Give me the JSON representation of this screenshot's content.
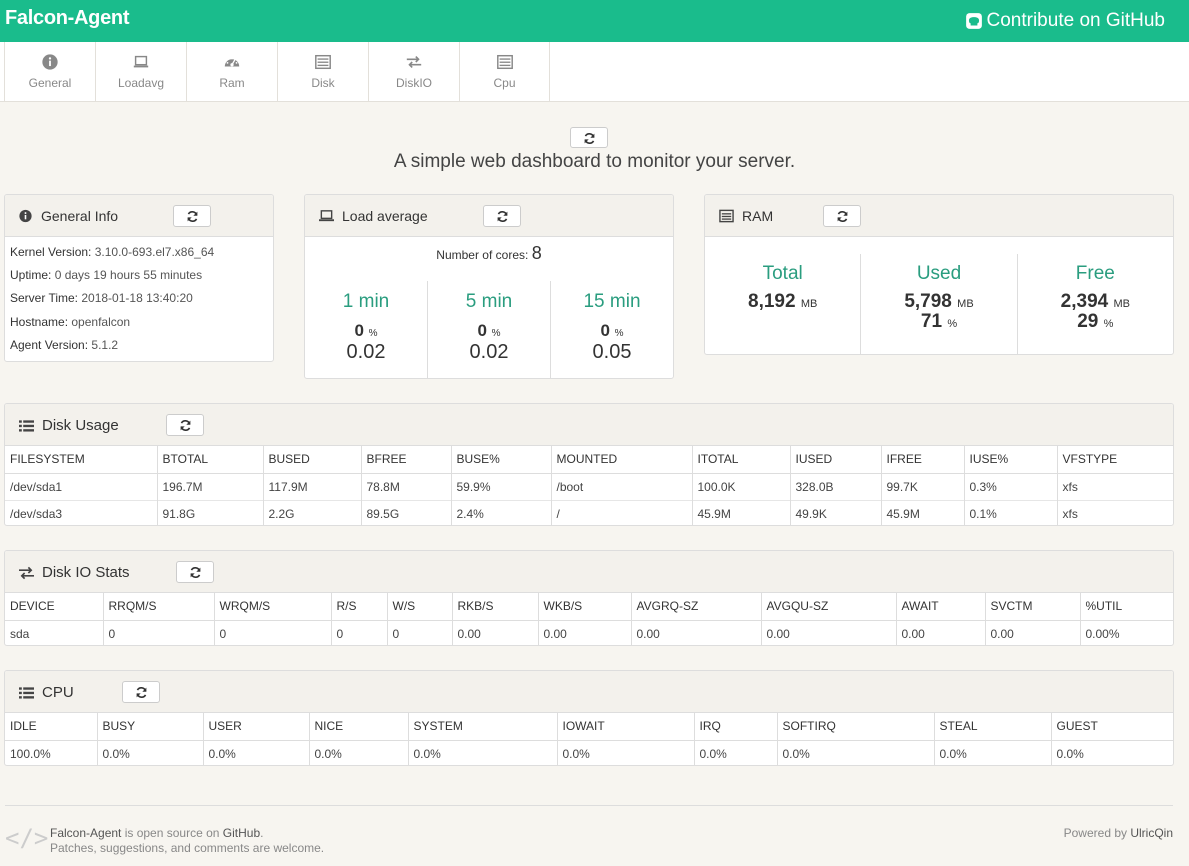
{
  "app": {
    "brand": "Falcon-Agent",
    "github_label": "Contribute on GitHub"
  },
  "nav": [
    {
      "label": "General",
      "icon": "info-circle-icon"
    },
    {
      "label": "Loadavg",
      "icon": "laptop-icon"
    },
    {
      "label": "Ram",
      "icon": "dashboard-icon"
    },
    {
      "label": "Disk",
      "icon": "list-alt-icon"
    },
    {
      "label": "DiskIO",
      "icon": "exchange-icon"
    },
    {
      "label": "Cpu",
      "icon": "list-alt-icon"
    }
  ],
  "tagline": "A simple web dashboard to monitor your server.",
  "general": {
    "title": "General Info",
    "rows": [
      {
        "k": "Kernel Version:",
        "v": "3.10.0-693.el7.x86_64"
      },
      {
        "k": "Uptime:",
        "v": "0 days 19 hours 55 minutes"
      },
      {
        "k": "Server Time:",
        "v": "2018-01-18 13:40:20"
      },
      {
        "k": "Hostname:",
        "v": "openfalcon"
      },
      {
        "k": "Agent Version:",
        "v": "5.1.2"
      }
    ]
  },
  "load": {
    "title": "Load average",
    "cores_label": "Number of cores:",
    "cores": "8",
    "cols": [
      {
        "h": "1 min",
        "pct": "0",
        "unit": "%",
        "val": "0.02"
      },
      {
        "h": "5 min",
        "pct": "0",
        "unit": "%",
        "val": "0.02"
      },
      {
        "h": "15 min",
        "pct": "0",
        "unit": "%",
        "val": "0.05"
      }
    ]
  },
  "ram": {
    "title": "RAM",
    "cols": [
      {
        "h": "Total",
        "v": "8,192",
        "vu": "MB",
        "p": "",
        "pu": ""
      },
      {
        "h": "Used",
        "v": "5,798",
        "vu": "MB",
        "p": "71",
        "pu": "%"
      },
      {
        "h": "Free",
        "v": "2,394",
        "vu": "MB",
        "p": "29",
        "pu": "%"
      }
    ]
  },
  "disk": {
    "title": "Disk Usage",
    "headers": [
      "FILESYSTEM",
      "BTOTAL",
      "BUSED",
      "BFREE",
      "BUSE%",
      "MOUNTED",
      "ITOTAL",
      "IUSED",
      "IFREE",
      "IUSE%",
      "VFSTYPE"
    ],
    "rows": [
      [
        "/dev/sda1",
        "196.7M",
        "117.9M",
        "78.8M",
        "59.9%",
        "/boot",
        "100.0K",
        "328.0B",
        "99.7K",
        "0.3%",
        "xfs"
      ],
      [
        "/dev/sda3",
        "91.8G",
        "2.2G",
        "89.5G",
        "2.4%",
        "/",
        "45.9M",
        "49.9K",
        "45.9M",
        "0.1%",
        "xfs"
      ]
    ]
  },
  "diskio": {
    "title": "Disk IO Stats",
    "headers": [
      "DEVICE",
      "RRQM/S",
      "WRQM/S",
      "R/S",
      "W/S",
      "RKB/S",
      "WKB/S",
      "AVGRQ-SZ",
      "AVGQU-SZ",
      "AWAIT",
      "SVCTM",
      "%UTIL"
    ],
    "rows": [
      [
        "sda",
        "0",
        "0",
        "0",
        "0",
        "0.00",
        "0.00",
        "0.00",
        "0.00",
        "0.00",
        "0.00",
        "0.00%"
      ]
    ]
  },
  "cpu": {
    "title": "CPU",
    "headers": [
      "IDLE",
      "BUSY",
      "USER",
      "NICE",
      "SYSTEM",
      "IOWAIT",
      "IRQ",
      "SOFTIRQ",
      "STEAL",
      "GUEST"
    ],
    "rows": [
      [
        "100.0%",
        "0.0%",
        "0.0%",
        "0.0%",
        "0.0%",
        "0.0%",
        "0.0%",
        "0.0%",
        "0.0%",
        "0.0%"
      ]
    ]
  },
  "footer": {
    "brand": "Falcon-Agent",
    "line1_mid": " is open source on ",
    "github": "GitHub",
    "line1_end": ".",
    "line2": "Patches, suggestions, and comments are welcome.",
    "powered": "Powered by ",
    "author": "UlricQin"
  }
}
